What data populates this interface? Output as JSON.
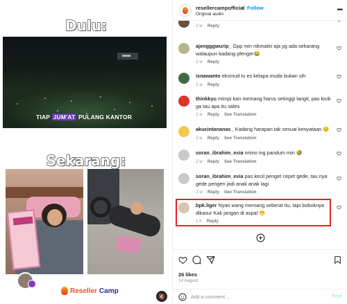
{
  "post": {
    "username": "resellercampofficial",
    "separator": "•",
    "follow_label": "Follow",
    "audio": "Original audio",
    "more_label": "•••"
  },
  "media": {
    "title_top": "Dulu:",
    "caption_pre": "TIAP ",
    "caption_highlight": "JUM'AT",
    "caption_post": " PULANG KANTOR",
    "title_bottom": "Sekarang:",
    "brand_part1": "Reseller",
    "brand_part2": "Camp",
    "mute_icon": "🔇"
  },
  "comments": [
    {
      "username": "",
      "text": "",
      "time": "2 w",
      "reply": "Reply",
      "translate": "",
      "avatar_color": "#6b4e3a"
    },
    {
      "username": "ajengggwurip_",
      "text": "Gpp min nikmatin aja yg ada sekarang walaupun kadang plenger😂",
      "time": "2 w",
      "reply": "Reply",
      "translate": "",
      "avatar_color": "#b7b58a"
    },
    {
      "username": "isnawanto",
      "text": "eksmud tu es kelapa muda bukan sih",
      "time": "2 w",
      "reply": "Reply",
      "translate": "",
      "avatar_color": "#3f6a4a"
    },
    {
      "username": "thinkkyu",
      "text": "mimpi kan memang harus setinggi langit, pas kicik ga tau apa itu sales",
      "time": "2 w",
      "reply": "Reply",
      "translate": "See Translation",
      "avatar_color": "#d9352b"
    },
    {
      "username": "akucintananas_",
      "text": "Kadang harapan tak sesuai kenyataan 😔",
      "time": "2 w",
      "reply": "Reply",
      "translate": "See Translation",
      "avatar_color": "#f2c94c"
    },
    {
      "username": "soran_ibrahim_exia",
      "text": "nrimo ing pandum min 🤣",
      "time": "2 w",
      "reply": "Reply",
      "translate": "See Translation",
      "avatar_color": "#c9c9c9"
    },
    {
      "username": "soran_ibrahim_exia",
      "text": "pas kecil penget cepet gede, tau nya gede pengen jadi anak anak lagi",
      "time": "2 w",
      "reply": "Reply",
      "translate": "See Translation",
      "avatar_color": "#c9c9c9"
    },
    {
      "username": "bpk.liger",
      "text": "Nyari wang memang seberat itu, tapi boboknya dikasur Kak jangan di aspal 😁",
      "time": "1 h",
      "reply": "Reply",
      "translate": "",
      "avatar_color": "#d8c4b4"
    }
  ],
  "footer": {
    "likes": "26 likes",
    "date": "14 August",
    "comment_placeholder": "Add a comment…",
    "post_label": "Post"
  },
  "icons": {
    "heart": "heart-icon",
    "comment": "comment-icon",
    "share": "share-icon",
    "save": "bookmark-icon",
    "emoji": "emoji-icon",
    "more": "more-icon",
    "load_more": "plus-circle-icon"
  },
  "colors": {
    "follow": "#0095f6",
    "highlight_border": "#e02424",
    "brand_orange": "#e8542a",
    "brand_navy": "#2a2a8f"
  }
}
